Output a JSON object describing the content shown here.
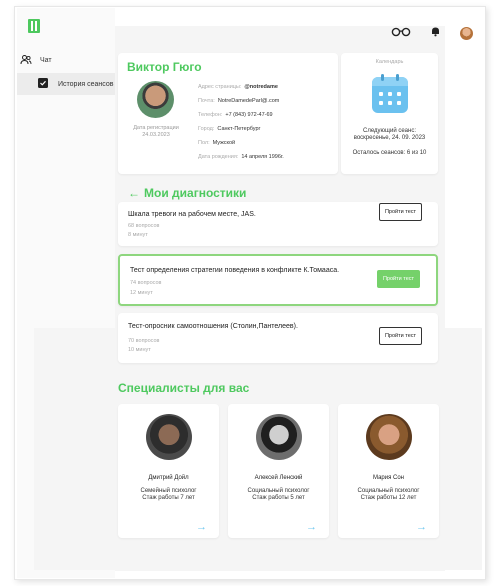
{
  "sidebar": {
    "items": [
      {
        "label": "Чат",
        "icon": "users-icon"
      },
      {
        "label": "История сеансов",
        "icon": "checkbox-icon"
      }
    ]
  },
  "topbar": {
    "icons": [
      "glasses-icon",
      "bell-icon",
      "avatar"
    ]
  },
  "profile": {
    "name": "Виктор Гюго",
    "reg_label": "Дата регистрации",
    "reg_date": "24.03.2023",
    "fields": [
      {
        "key": "Адрес страницы:",
        "value": "@notredame"
      },
      {
        "key": "Почта:",
        "value": "NotreDamedeParl@.com"
      },
      {
        "key": "Телефон:",
        "value": "+7 (843) 972-47-69"
      },
      {
        "key": "Город:",
        "value": "Санкт-Петербург"
      },
      {
        "key": "Пол:",
        "value": "Мужской"
      },
      {
        "key": "Дата рождения:",
        "value": "14 апреля 1996г."
      }
    ]
  },
  "calendar": {
    "title": "Календарь",
    "next_label": "Следующий сеанс:",
    "next_value": "воскресенье, 24. 09. 2023",
    "remaining": "Осталось сеансов: 6 из 10"
  },
  "diagnostics": {
    "title": "Мои диагностики",
    "tests": [
      {
        "title": "Шкала тревоги на рабочем месте, JAS.",
        "questions": "68 вопросов",
        "duration": "8 минут",
        "button": "Пройти тест",
        "highlight": false
      },
      {
        "title": "Тест определения стратегии поведения в конфликте К.Томааса.",
        "questions": "74 вопросов",
        "duration": "12 минут",
        "button": "Пройти тест",
        "highlight": true
      },
      {
        "title": "Тест-опросник самоотношения (Столин,Пантелеев).",
        "questions": "70 вопросов",
        "duration": "10 минут",
        "button": "Пройти тест",
        "highlight": false
      }
    ]
  },
  "specialists": {
    "title": "Специалисты для вас",
    "items": [
      {
        "name": "Дмитрий Дойл",
        "role": "Семейный психолог",
        "experience": "Стаж работы 7 лет"
      },
      {
        "name": "Алексей Ленский",
        "role": "Социальный психолог",
        "experience": "Стаж работы 5 лет"
      },
      {
        "name": "Мария Сон",
        "role": "Социальный психолог",
        "experience": "Стаж работы 12 лет"
      }
    ]
  },
  "colors": {
    "accent": "#4ec95f",
    "button_green": "#75d16a",
    "link_blue": "#6fc7ef"
  }
}
